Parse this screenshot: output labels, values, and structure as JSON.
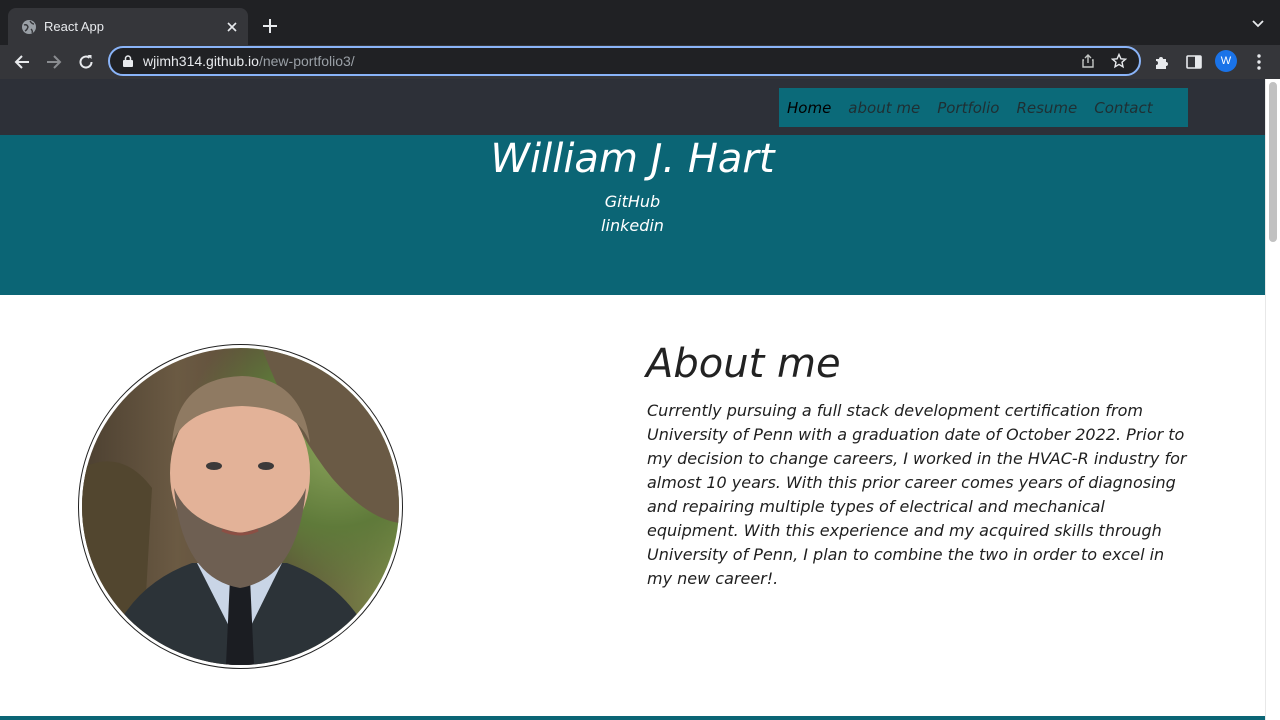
{
  "browser": {
    "tab_title": "React App",
    "url_host": "wjimh314.github.io",
    "url_path": "/new-portfolio3/",
    "profile_initial": "W"
  },
  "nav": {
    "items": [
      {
        "label": "Home",
        "active": true
      },
      {
        "label": "about me",
        "active": false
      },
      {
        "label": "Portfolio",
        "active": false
      },
      {
        "label": "Resume",
        "active": false
      },
      {
        "label": "Contact",
        "active": false
      }
    ]
  },
  "hero": {
    "name": "William J. Hart",
    "links": [
      "GitHub",
      "linkedin"
    ]
  },
  "about": {
    "title": "About me",
    "lines": [
      "Currently pursuing a full stack development certification from",
      "University of Penn with a graduation date of October 2022. Prior to",
      "my decision to change careers, I worked in the HVAC-R industry for",
      "almost 10 years. With this prior career comes years of diagnosing",
      "and repairing multiple types of electrical and mechanical",
      "equipment. With this experience and my acquired skills through",
      "University of Penn, I plan to combine the two in order to excel in",
      "my new career!."
    ]
  },
  "colors": {
    "accent": "#0b6575",
    "nav_bg": "#2d3038",
    "nav_links_bg": "#0b6a79"
  }
}
